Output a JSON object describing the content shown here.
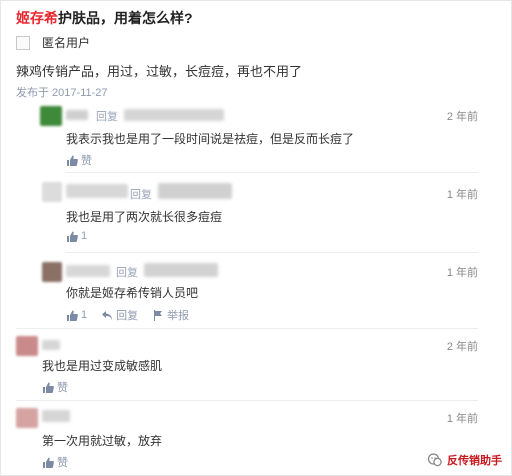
{
  "question": {
    "brand": "姬存希",
    "rest": "护肤品，用着怎么样?"
  },
  "post": {
    "user_name": "匿名用户",
    "content": "辣鸡传销产品，用过，过敏，长痘痘，再也不用了",
    "date": "发布于 2017-11-27"
  },
  "replies": [
    {
      "reply_word": "回复",
      "time": "2 年前",
      "text": "我表示我也是用了一段时间说是祛痘，但是反而长痘了",
      "like_label": "赞",
      "avatar_color": "#3f8a3a"
    },
    {
      "reply_word": "回复",
      "time": "1 年前",
      "text": "我也是用了两次就长很多痘痘",
      "like_count": "1",
      "avatar_color": "#d9d9d9"
    },
    {
      "reply_word": "回复",
      "time": "1 年前",
      "text": "你就是姬存希传销人员吧",
      "like_count": "1",
      "reply_action": "回复",
      "report_action": "举报",
      "avatar_color": "#8b7066"
    },
    {
      "time": "2 年前",
      "text": "我也是用过变成敏感肌",
      "like_label": "赞",
      "avatar_color": "#c98a8a"
    },
    {
      "time": "1 年前",
      "text": "第一次用就过敏，放弃",
      "like_label": "赞",
      "avatar_color": "#d6a3a3"
    }
  ],
  "watermark": {
    "text": "反传销助手"
  },
  "colors": {
    "brand": "#e8272f",
    "meta": "#8f9bb0",
    "watermark": "#c8191f"
  }
}
